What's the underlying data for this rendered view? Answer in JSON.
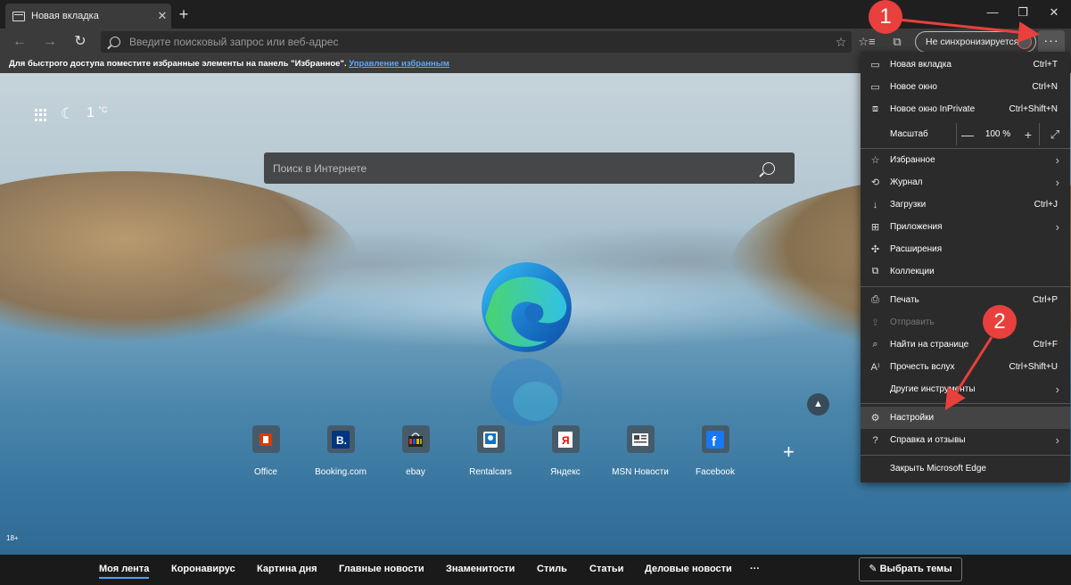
{
  "tab": {
    "title": "Новая вкладка",
    "close": "✕"
  },
  "window": {
    "minimize": "—",
    "restore": "❐",
    "close": "✕",
    "newtab": "+"
  },
  "toolbar": {
    "back": "←",
    "forward": "→",
    "refresh": "↻",
    "address_placeholder": "Введите поисковый запрос или веб-адрес",
    "favorite_star": "☆",
    "sync_label": "Не синхронизируется",
    "more": "···"
  },
  "favbar": {
    "text": "Для быстрого доступа поместите избранные элементы на панель \"Избранное\".",
    "link": "Управление избранным"
  },
  "weather": {
    "temp": "1",
    "unit": "°C"
  },
  "search": {
    "placeholder": "Поиск в Интернете"
  },
  "tiles": [
    {
      "label": "Office",
      "icon": "office-icon",
      "color": "#d83b01"
    },
    {
      "label": "Booking.com",
      "icon": "booking-icon",
      "color": "#003580"
    },
    {
      "label": "ebay",
      "icon": "ebay-icon",
      "color": "#222222"
    },
    {
      "label": "Rentalcars",
      "icon": "rentalcars-icon",
      "color": "#1273c6"
    },
    {
      "label": "Яндекс",
      "icon": "yandex-icon",
      "color": "#ff0000"
    },
    {
      "label": "MSN Новости",
      "icon": "msn-icon",
      "color": "#444444"
    },
    {
      "label": "Facebook",
      "icon": "facebook-icon",
      "color": "#1877f2"
    }
  ],
  "age_badge": "18+",
  "news": {
    "items": [
      "Моя лента",
      "Коронавирус",
      "Картина дня",
      "Главные новости",
      "Знаменитости",
      "Стиль",
      "Статьи",
      "Деловые новости"
    ],
    "more": "···",
    "topics_button": "✎ Выбрать темы"
  },
  "menu": {
    "new_tab": {
      "label": "Новая вкладка",
      "key": "Ctrl+T"
    },
    "new_window": {
      "label": "Новое окно",
      "key": "Ctrl+N"
    },
    "new_inprivate": {
      "label": "Новое окно InPrivate",
      "key": "Ctrl+Shift+N"
    },
    "zoom": {
      "label": "Масштаб",
      "minus": "—",
      "value": "100 %",
      "plus": "+",
      "full": "⤢"
    },
    "favorites": {
      "label": "Избранное"
    },
    "history": {
      "label": "Журнал"
    },
    "downloads": {
      "label": "Загрузки",
      "key": "Ctrl+J"
    },
    "apps": {
      "label": "Приложения"
    },
    "extensions": {
      "label": "Расширения"
    },
    "collections": {
      "label": "Коллекции"
    },
    "print": {
      "label": "Печать",
      "key": "Ctrl+P"
    },
    "share": {
      "label": "Отправить"
    },
    "find": {
      "label": "Найти на странице",
      "key": "Ctrl+F"
    },
    "read_aloud": {
      "label": "Прочесть вслух",
      "key": "Ctrl+Shift+U"
    },
    "more_tools": {
      "label": "Другие инструменты"
    },
    "settings": {
      "label": "Настройки"
    },
    "help": {
      "label": "Справка и отзывы"
    },
    "close_edge": {
      "label": "Закрыть Microsoft Edge"
    }
  },
  "annotations": {
    "step1": "1",
    "step2": "2",
    "color": "#e8403c"
  }
}
